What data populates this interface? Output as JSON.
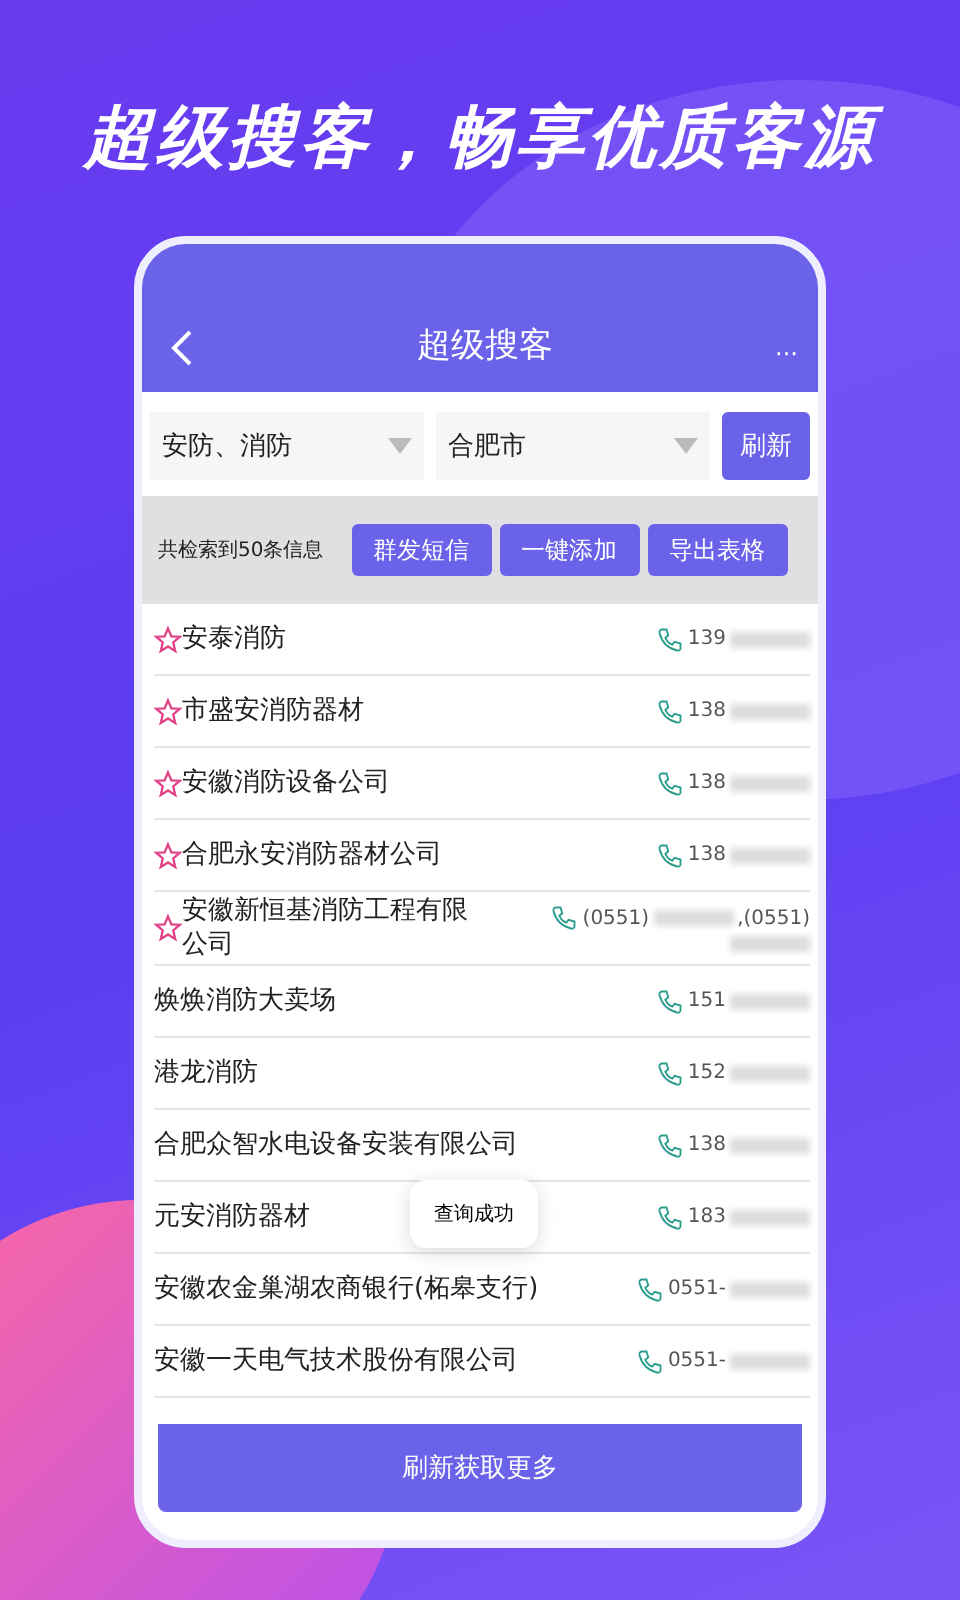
{
  "headline": "超级搜客，畅享优质客源",
  "header": {
    "title": "超级搜客",
    "more": "···"
  },
  "filters": [
    {
      "value": "安防、消防"
    },
    {
      "value": "合肥市"
    }
  ],
  "refresh_button": "刷新",
  "summary": "共检索到50条信息",
  "actions": [
    "群发短信",
    "一键添加",
    "导出表格"
  ],
  "rows": [
    {
      "name": "安泰消防",
      "star": true,
      "phone": [
        {
          "kind": "text",
          "text": "139"
        },
        {
          "kind": "blur"
        }
      ]
    },
    {
      "name": "市盛安消防器材",
      "star": true,
      "phone": [
        {
          "kind": "text",
          "text": "138"
        },
        {
          "kind": "blur"
        }
      ]
    },
    {
      "name": "安徽消防设备公司",
      "star": true,
      "phone": [
        {
          "kind": "text",
          "text": "138"
        },
        {
          "kind": "blur"
        }
      ]
    },
    {
      "name": "合肥永安消防器材公司",
      "star": true,
      "phone": [
        {
          "kind": "text",
          "text": "138"
        },
        {
          "kind": "blur"
        }
      ]
    },
    {
      "name": "安徽新恒基消防工程有限公司",
      "star": true,
      "phone": [
        {
          "kind": "text",
          "text": "(0551)"
        },
        {
          "kind": "blur"
        },
        {
          "kind": "text",
          "text": ",(0551)"
        },
        {
          "kind": "blur"
        }
      ]
    },
    {
      "name": "焕焕消防大卖场",
      "star": false,
      "phone": [
        {
          "kind": "text",
          "text": "151"
        },
        {
          "kind": "blur"
        }
      ]
    },
    {
      "name": "港龙消防",
      "star": false,
      "phone": [
        {
          "kind": "text",
          "text": "152"
        },
        {
          "kind": "blur"
        }
      ]
    },
    {
      "name": "合肥众智水电设备安装有限公司",
      "star": false,
      "phone": [
        {
          "kind": "text",
          "text": "138"
        },
        {
          "kind": "blur"
        }
      ]
    },
    {
      "name": "元安消防器材",
      "star": false,
      "phone": [
        {
          "kind": "text",
          "text": "183"
        },
        {
          "kind": "blur"
        }
      ]
    },
    {
      "name": "安徽农金巢湖农商银行(柘皋支行)",
      "star": false,
      "phone": [
        {
          "kind": "text",
          "text": "0551-"
        },
        {
          "kind": "blur"
        }
      ]
    },
    {
      "name": "安徽一天电气技术股份有限公司",
      "star": false,
      "phone": [
        {
          "kind": "text",
          "text": "0551-"
        },
        {
          "kind": "blur"
        }
      ]
    }
  ],
  "toast": "查询成功",
  "load_more_button": "刷新获取更多"
}
